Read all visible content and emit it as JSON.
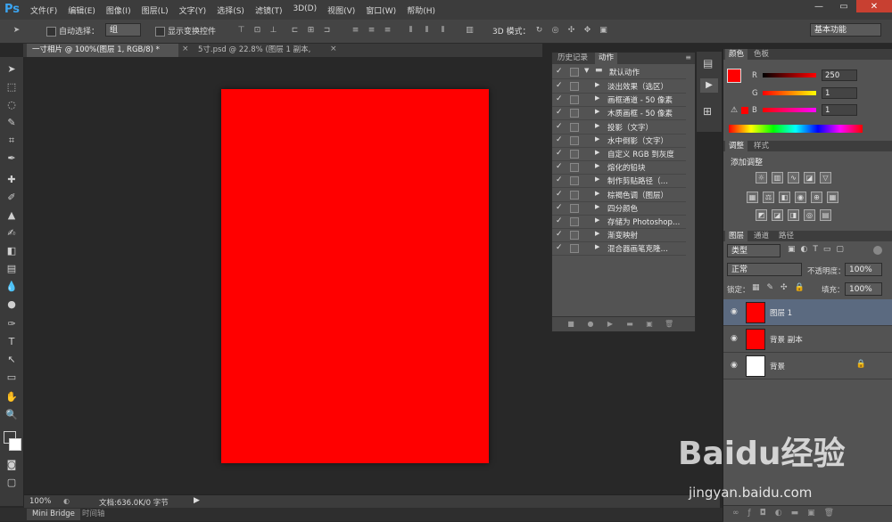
{
  "app": {
    "logo": "Ps"
  },
  "menu": [
    "文件(F)",
    "编辑(E)",
    "图像(I)",
    "图层(L)",
    "文字(Y)",
    "选择(S)",
    "滤镜(T)",
    "3D(D)",
    "视图(V)",
    "窗口(W)",
    "帮助(H)"
  ],
  "window_controls": {
    "minimize": "—",
    "restore": "▭",
    "close": "✕"
  },
  "options": {
    "auto_select_label": "自动选择：",
    "auto_select_value": "组",
    "show_transform_label": "显示变换控件",
    "mode_3d_label": "3D 模式：",
    "workspace": "基本功能"
  },
  "doc_tabs": [
    {
      "label": "一寸相片 @ 100%(图层 1, RGB/8) *"
    },
    {
      "label": "5寸.psd @ 22.8% (图层 1 副本, RGB/8)"
    }
  ],
  "tab_close": "×",
  "status": {
    "zoom": "100%",
    "doc_info": "文档:636.0K/0 字节"
  },
  "bottom_tabs": [
    "Mini Bridge",
    "时间轴"
  ],
  "actions_panel": {
    "tabs": [
      "历史记录",
      "动作"
    ],
    "set_name": "默认动作",
    "actions": [
      "淡出效果（选区）",
      "画框通道 - 50 像素",
      "木质画框 - 50 像素",
      "投影（文字）",
      "水中倒影（文字）",
      "自定义 RGB 到灰度",
      "熔化的铅块",
      "制作剪贴路径（…",
      "棕褐色调（图层）",
      "四分颜色",
      "存储为 Photoshop…",
      "渐变映射",
      "混合器画笔克隆…"
    ]
  },
  "color_panel": {
    "tabs": [
      "颜色",
      "色板"
    ],
    "channels": [
      {
        "label": "R",
        "value": "250"
      },
      {
        "label": "G",
        "value": "1"
      },
      {
        "label": "B",
        "value": "1"
      }
    ]
  },
  "adjust_panel": {
    "tabs": [
      "调整",
      "样式"
    ],
    "title": "添加调整"
  },
  "layers_panel": {
    "tabs": [
      "图层",
      "通道",
      "路径"
    ],
    "filter": "类型",
    "blend_mode": "正常",
    "opacity_label": "不透明度：",
    "opacity": "100%",
    "lock_label": "锁定：",
    "fill_label": "填充：",
    "fill": "100%",
    "layers": [
      {
        "name": "图层 1",
        "color": "#ff0000",
        "selected": true
      },
      {
        "name": "背景 副本",
        "color": "#ff0000",
        "selected": false
      },
      {
        "name": "背景",
        "color": "#ffffff",
        "selected": false,
        "locked": true
      }
    ]
  },
  "colors": {
    "foreground": "#ff0000",
    "background": "#ffffff",
    "canvas": "#ff0000"
  },
  "watermark": {
    "brand": "Baidu经验",
    "url": "jingyan.baidu.com"
  }
}
